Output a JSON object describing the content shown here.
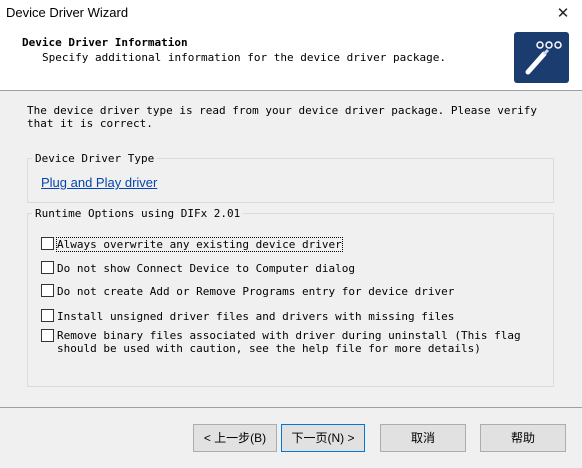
{
  "window": {
    "title": "Device Driver Wizard",
    "close_glyph": "✕"
  },
  "header": {
    "title": "Device Driver Information",
    "subtitle": "Specify additional information for the device driver package."
  },
  "intro": "The device driver type is read from your device driver package. Please verify that it is correct.",
  "driver_type": {
    "legend": "Device Driver Type",
    "value": "Plug and Play driver"
  },
  "options": {
    "legend": "Runtime Options using DIFx 2.01",
    "items": [
      {
        "label": "Always overwrite any existing device driver",
        "checked": false
      },
      {
        "label": "Do not show Connect Device to Computer dialog",
        "checked": false
      },
      {
        "label": "Do not create Add or Remove Programs entry for device driver",
        "checked": false
      },
      {
        "label": "Install unsigned driver files and drivers with missing files",
        "checked": false
      },
      {
        "label": "Remove binary files associated with driver during uninstall (This flag should be used with caution, see the help file for more details)",
        "checked": false
      }
    ]
  },
  "buttons": {
    "back": "< 上一步(B)",
    "next": "下一页(N) >",
    "cancel": "取消",
    "help": "帮助"
  },
  "colors": {
    "logo_bg": "#1b3c6e",
    "link": "#0645ad",
    "focus_border": "#0078d7"
  }
}
